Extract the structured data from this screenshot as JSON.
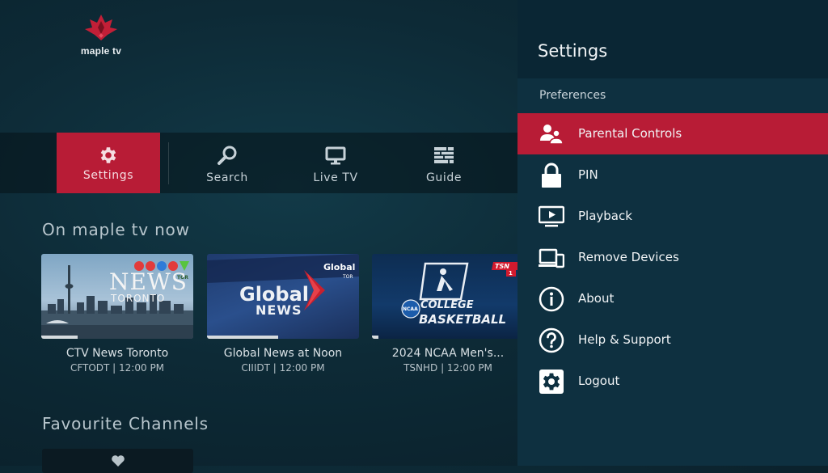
{
  "app": {
    "logo_text": "maple tv"
  },
  "nav": {
    "settings": "Settings",
    "search": "Search",
    "live_tv": "Live TV",
    "guide": "Guide"
  },
  "sections": {
    "now": "On maple tv now",
    "favourites": "Favourite Channels"
  },
  "cards": [
    {
      "title": "CTV News Toronto",
      "subtitle": "CFTODT | 12:00 PM",
      "progress": 0.24,
      "thumb": {
        "brand": "CTV",
        "headline": "NEWS",
        "place": "TORONTO",
        "tag": "TOR"
      }
    },
    {
      "title": "Global News at Noon",
      "subtitle": "CIIIDT | 12:00 PM",
      "progress": 0.47,
      "thumb": {
        "brand": "Global",
        "headline": "Global",
        "headline2": "NEWS",
        "tag": "TOR"
      }
    },
    {
      "title": "2024 NCAA Men's...",
      "subtitle": "TSNHD | 12:00 PM",
      "progress": 0.04,
      "thumb": {
        "brand": "TSN",
        "num": "1",
        "line1": "COLLEGE",
        "line2": "BASKETBALL",
        "badge": "NCAA"
      }
    }
  ],
  "panel": {
    "title": "Settings",
    "section": "Preferences",
    "items": [
      {
        "label": "Parental Controls",
        "icon": "parental-icon",
        "active": true
      },
      {
        "label": "PIN",
        "icon": "lock-icon",
        "active": false
      },
      {
        "label": "Playback",
        "icon": "playback-icon",
        "active": false
      },
      {
        "label": "Remove Devices",
        "icon": "devices-icon",
        "active": false
      },
      {
        "label": "About",
        "icon": "info-icon",
        "active": false
      },
      {
        "label": "Help & Support",
        "icon": "help-icon",
        "active": false
      },
      {
        "label": "Logout",
        "icon": "gear-icon",
        "active": false
      }
    ]
  },
  "colors": {
    "accent": "#b81c36",
    "panel": "#0e3040",
    "panel_header": "#0a2634"
  }
}
